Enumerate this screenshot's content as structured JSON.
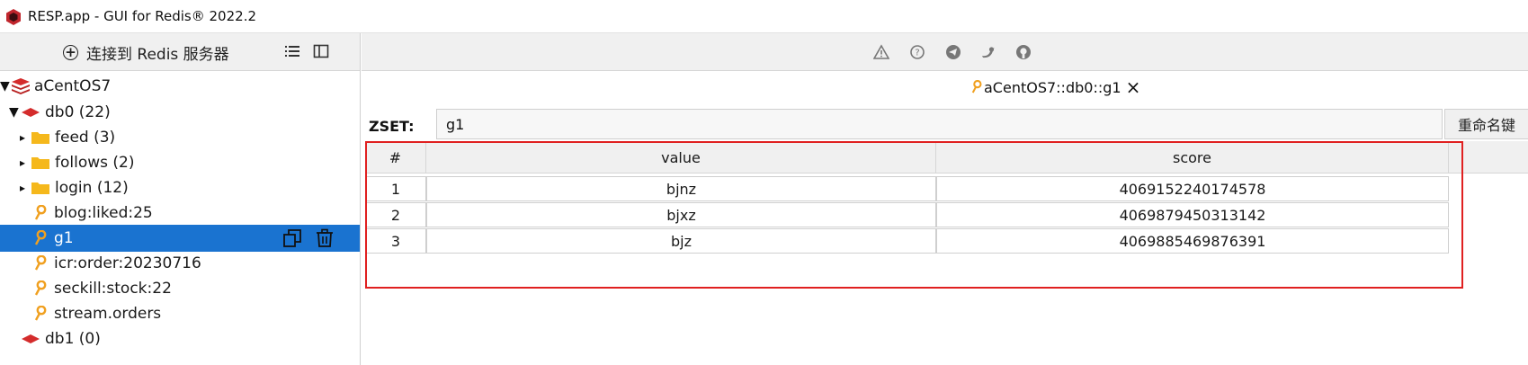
{
  "window": {
    "title": "RESP.app - GUI for Redis® 2022.2"
  },
  "sidebar": {
    "connect_label": "连接到 Redis 服务器",
    "tree": [
      {
        "label": "aCentOS7",
        "type": "server"
      },
      {
        "label": "db0  (22)",
        "type": "db"
      },
      {
        "label": "feed (3)",
        "type": "folder"
      },
      {
        "label": "follows (2)",
        "type": "folder"
      },
      {
        "label": "login (12)",
        "type": "folder"
      },
      {
        "label": "blog:liked:25",
        "type": "key"
      },
      {
        "label": "g1",
        "type": "key",
        "selected": true
      },
      {
        "label": "icr:order:20230716",
        "type": "key"
      },
      {
        "label": "seckill:stock:22",
        "type": "key"
      },
      {
        "label": "stream.orders",
        "type": "key"
      },
      {
        "label": "db1  (0)",
        "type": "db"
      }
    ]
  },
  "tab": {
    "label": "aCentOS7::db0::g1",
    "close": "×"
  },
  "key_view": {
    "type_label": "ZSET:",
    "key_name": "g1",
    "rename_label": "重命名键"
  },
  "table": {
    "columns": [
      "#",
      "value",
      "score"
    ],
    "rows": [
      {
        "index": "1",
        "value": "bjnz",
        "score": "4069152240174578"
      },
      {
        "index": "2",
        "value": "bjxz",
        "score": "4069879450313142"
      },
      {
        "index": "3",
        "value": "bjz",
        "score": "4069885469876391"
      }
    ]
  },
  "colors": {
    "selection": "#1a73d0",
    "highlight_border": "#e02020",
    "key_icon": "#f0a020",
    "folder_icon": "#f5b81c",
    "db_icon": "#e03c3c"
  }
}
